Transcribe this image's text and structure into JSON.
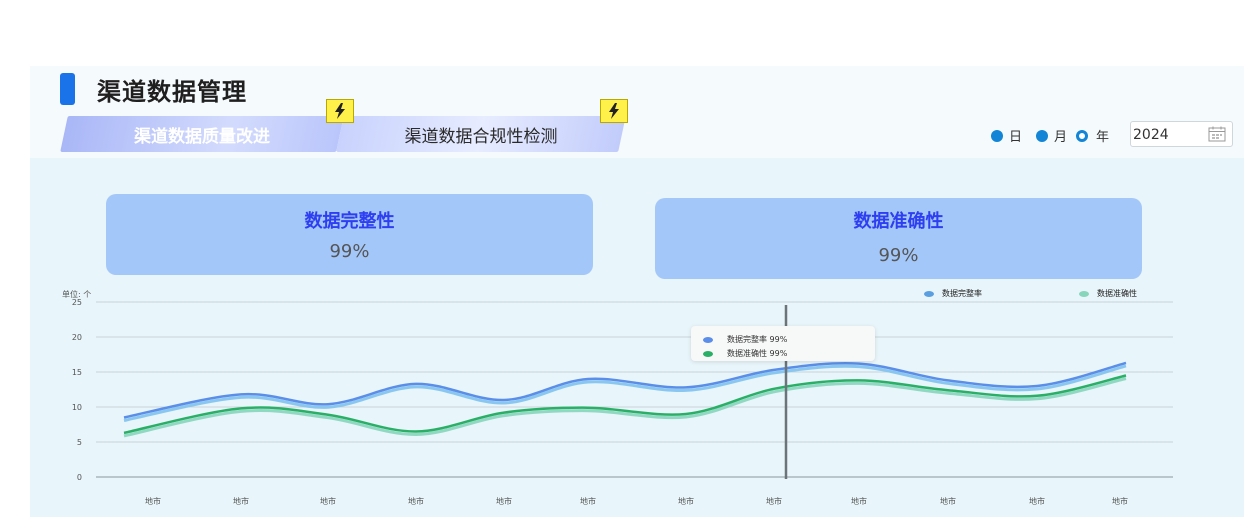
{
  "header": {
    "title": "渠道数据管理"
  },
  "tabs": [
    {
      "label": "渠道数据质量改进",
      "active": true
    },
    {
      "label": "渠道数据合规性检测",
      "active": false
    }
  ],
  "period": {
    "options": [
      {
        "label": "日",
        "state": "filled"
      },
      {
        "label": "月",
        "state": "filled"
      },
      {
        "label": "年",
        "state": "selected"
      }
    ],
    "year": "2024"
  },
  "metrics": [
    {
      "title": "数据完整性",
      "value": "99%"
    },
    {
      "title": "数据准确性",
      "value": "99%"
    }
  ],
  "chart_data": {
    "type": "line",
    "unit_label": "单位: 个",
    "categories": [
      "地市",
      "地市",
      "地市",
      "地市",
      "地市",
      "地市",
      "地市",
      "地市",
      "地市",
      "地市",
      "地市",
      "地市"
    ],
    "ylim": [
      0,
      25
    ],
    "yticks": [
      0,
      5,
      10,
      15,
      20,
      25
    ],
    "grid": true,
    "legend_position": "top-right",
    "series": [
      {
        "name": "数据完整率",
        "color": "#5b8ee8",
        "shadow": "#7fc2ee",
        "values": [
          8.5,
          11.8,
          10.4,
          13.3,
          11.0,
          14.0,
          12.8,
          15.3,
          16.2,
          13.8,
          13.0,
          16.3
        ]
      },
      {
        "name": "数据准确性",
        "color": "#2aaf66",
        "shadow": "#87d5bb",
        "values": [
          6.3,
          9.8,
          8.9,
          6.5,
          9.2,
          9.9,
          9.0,
          12.6,
          13.8,
          12.4,
          11.6,
          14.5
        ]
      }
    ],
    "cursor_index": 7,
    "tooltip": [
      {
        "text": "数据完整率 99%",
        "color": "#5b8ee8"
      },
      {
        "text": "数据准确性 99%",
        "color": "#2aaf66"
      }
    ]
  }
}
